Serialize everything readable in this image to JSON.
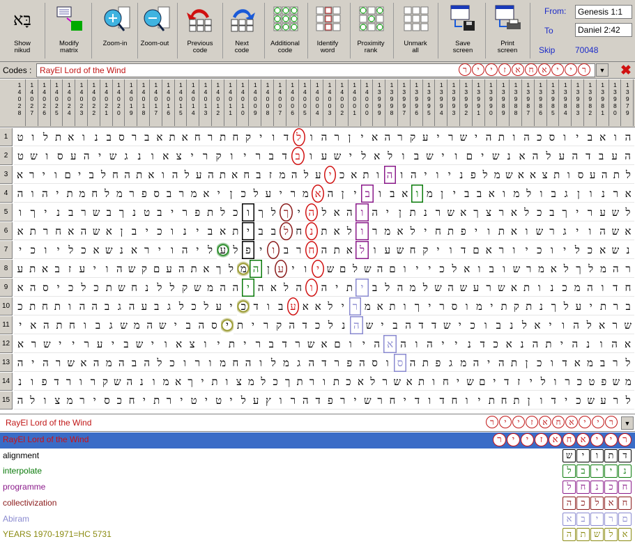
{
  "toolbar": {
    "buttons": [
      {
        "name": "show-nikud",
        "label": "Show\nnikud",
        "icon": "hebrew-letters-icon",
        "glyph": "בָּא"
      },
      {
        "name": "modify-matrix",
        "label": "Modify\nmatrix",
        "icon": "matrix-icon"
      },
      {
        "name": "zoom-in",
        "label": "Zoom-in",
        "icon": "zoom-in-icon"
      },
      {
        "name": "zoom-out",
        "label": "Zoom-out",
        "icon": "zoom-out-icon"
      },
      {
        "name": "previous-code",
        "label": "Previous\ncode",
        "icon": "previous-code-icon"
      },
      {
        "name": "next-code",
        "label": "Next\ncode",
        "icon": "next-code-icon"
      },
      {
        "name": "additional-code",
        "label": "Additional\ncode",
        "icon": "additional-code-icon"
      },
      {
        "name": "identify-word",
        "label": "Identify\nword",
        "icon": "identify-word-icon"
      },
      {
        "name": "proximity-rank",
        "label": "Proximity\nrank",
        "icon": "proximity-rank-icon"
      },
      {
        "name": "unmark-all",
        "label": "Unmark\nall",
        "icon": "unmark-icon"
      },
      {
        "name": "save-screen",
        "label": "Save\nscreen",
        "icon": "save-icon"
      },
      {
        "name": "print-screen",
        "label": "Print\nscreen",
        "icon": "print-icon"
      }
    ],
    "range": {
      "from_label": "From:",
      "from_value": "Genesis 1:1",
      "to_label": "To",
      "to_value": "Daniel 2:42",
      "skip_label": "Skip",
      "skip_value": "70048"
    }
  },
  "codes": {
    "label": "Codes :",
    "value": "RayEl Lord of the Wind",
    "glyphs": "רייזאחאייר"
  },
  "columns": [
    "1\n4\n0\n2\n8",
    "1\n4\n0\n2\n7",
    "1\n4\n0\n2\n6",
    "1\n4\n0\n2\n5",
    "1\n4\n0\n2\n4",
    "1\n4\n0\n2\n3",
    "1\n4\n0\n2\n2",
    "1\n4\n0\n2\n1",
    "1\n4\n0\n2\n0",
    "1\n4\n0\n1\n9",
    "1\n4\n0\n1\n8",
    "1\n4\n0\n1\n7",
    "1\n4\n0\n1\n6",
    "1\n4\n0\n1\n5",
    "1\n4\n0\n1\n4",
    "1\n4\n0\n1\n3",
    "1\n4\n0\n1\n2",
    "1\n4\n0\n1\n1",
    "1\n4\n0\n1\n0",
    "1\n4\n0\n0\n9",
    "1\n4\n0\n0\n8",
    "1\n4\n0\n0\n7",
    "1\n4\n0\n0\n6",
    "1\n4\n0\n0\n5",
    "1\n4\n0\n0\n4",
    "1\n4\n0\n0\n3",
    "1\n4\n0\n0\n2",
    "1\n4\n0\n0\n1",
    "1\n4\n0\n0\n0",
    "1\n3\n9\n9\n9",
    "1\n3\n9\n9\n8",
    "1\n3\n9\n9\n7",
    "1\n3\n9\n9\n6",
    "1\n3\n9\n9\n5",
    "1\n3\n9\n9\n4",
    "1\n3\n9\n9\n3",
    "1\n3\n9\n9\n2",
    "1\n3\n9\n9\n1",
    "1\n3\n9\n9\n0",
    "1\n3\n9\n8\n9",
    "1\n3\n9\n8\n8",
    "1\n3\n9\n8\n7",
    "1\n3\n9\n8\n6",
    "1\n3\n9\n8\n5",
    "1\n3\n9\n8\n4",
    "1\n3\n9\n8\n3",
    "1\n3\n9\n8\n2",
    "1\n3\n9\n8\n1",
    "1\n3\n9\n8\n0",
    "1\n3\n9\n7\n9"
  ],
  "rows": [
    {
      "n": "1",
      "text": "הואביוסכהותהישריעקרהאיןרהולדויקחתרחאתאברסבנואתלוט"
    },
    {
      "n": "2",
      "text": "העבדהעלהאנשיםוישבולאלישעובדבריוקריצאונגשיהעסושט"
    },
    {
      "n": "3",
      "text": "לתהעסותצאאשמלפניויהוהותאכיעלהמזבחאתהעלהואתהחלביםוירא"
    },
    {
      "n": "4",
      "text": "ארנוןגבולמואבביןמואבוביןהאמריעלכןיאמרבספרמלחמתיהוה"
    },
    {
      "n": "5",
      "text": "לשעריךבכלארצךאשרנתןיהוהאלהיךלךוכלתפריבטנךבשרבניךו"
    },
    {
      "n": "6",
      "text": "אשהויגרשואתויפתחילאמרולאתנחלבביתאבינוכיבןאשהאחרתא"
    },
    {
      "n": "7",
      "text": "נשאכליוכיוראםדויקחשעולאתהחרבויפלעליהויראנשאכליוכי"
    },
    {
      "n": "8",
      "text": "רהמלךלאמרשובואלכייוםהשלםשיויעןהמלךאתהעםקשהויעזבאתע"
    },
    {
      "n": "9",
      "text": "חדוהמכנותאשרעשהשלמהלביתיהוהלאהיההמשקללנחשתכלכיסהא"
    },
    {
      "n": "10",
      "text": "ברתיעלךנתקתימוסריךותאמרילאאעבודכיעלכלגבעהגבההותחתכ"
    },
    {
      "n": "11",
      "text": "שראלהויאלנבוכישדדהבישהנלכדהקריתיסהבישהמשגבוחתהאי"
    },
    {
      "n": "12",
      "text": "אהונהיתהנאכדנייהוהאהיוםאשרדבריתיוצאוישביעריישרא"
    },
    {
      "n": "13",
      "text": "לרבמאדוכןתהיהמגפתהסוסהפרדהגמלוהחמורוכלהבהמהאשרהיה"
    },
    {
      "n": "14",
      "text": "משפטכרוליזדיםשיחותאשרלאכתורתךכלמצותיךאמונהשקרורדפונ"
    },
    {
      "n": "15",
      "text": "לרעשכידוןתחתיוחדודיחרשירפדהרוץעליטיטירתיחכסירמצולה"
    }
  ],
  "term_selector": {
    "value": "RayEl Lord of the Wind",
    "glyphs": "רייזאחאייר"
  },
  "terms": [
    {
      "label": "RayEl Lord of the Wind",
      "color": "#d01010",
      "glyphs": "רייזאחאייר",
      "selected": true
    },
    {
      "label": "alignment",
      "color": "#000000",
      "glyphs": "שיותד"
    },
    {
      "label": "interpolate",
      "color": "#0a7a0a",
      "glyphs": "לביינ"
    },
    {
      "label": "programme",
      "color": "#8a1a8a",
      "glyphs": "לחנכח"
    },
    {
      "label": "collectivization",
      "color": "#8a1a1a",
      "glyphs": "הכלאח"
    },
    {
      "label": "Abiram",
      "color": "#8a8ad0",
      "glyphs": "אבירם"
    },
    {
      "label": "YEARS 1970-1971=HC 5731",
      "color": "#8a8a10",
      "glyphs": "התשלא"
    }
  ],
  "colors": {
    "code_red": "#c01515",
    "toolbar_bg": "#d4d0c8",
    "selection": "#3a6cc7",
    "range_blue": "#1b2ac9"
  }
}
